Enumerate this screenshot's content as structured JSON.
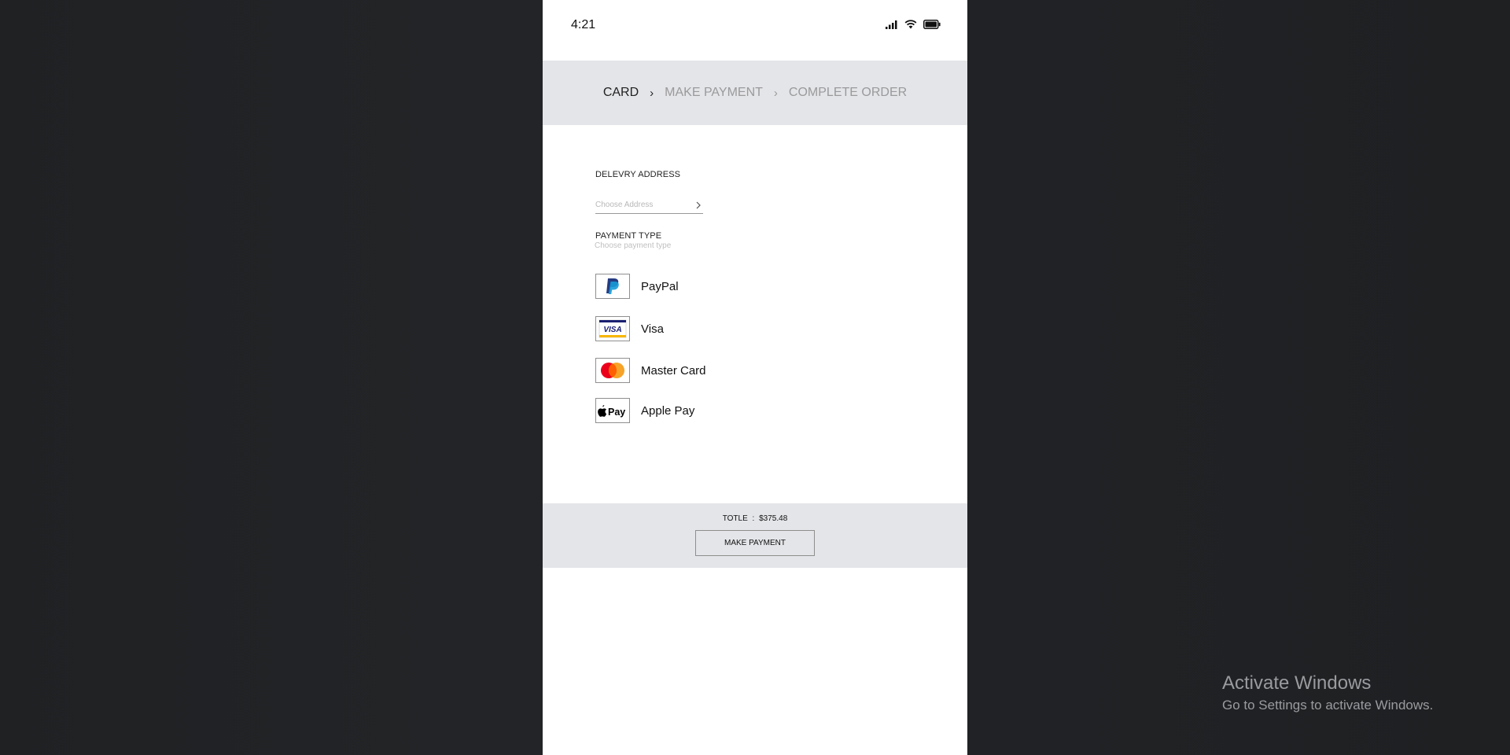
{
  "status_bar": {
    "time": "4:21"
  },
  "stepper": {
    "steps": [
      {
        "label": "CARD",
        "state": "active"
      },
      {
        "label": "MAKE PAYMENT",
        "state": "inactive"
      },
      {
        "label": "COMPLETE ORDER",
        "state": "inactive"
      }
    ],
    "separator": "›"
  },
  "delivery": {
    "title": "DELEVRY ADDRESS",
    "placeholder": "Choose Address"
  },
  "payment": {
    "title": "PAYMENT TYPE",
    "hint": "Choose payment type",
    "options": [
      {
        "label": "PayPal",
        "icon": "paypal-icon"
      },
      {
        "label": "Visa",
        "icon": "visa-icon"
      },
      {
        "label": "Master Card",
        "icon": "mastercard-icon"
      },
      {
        "label": "Apple Pay",
        "icon": "apple-pay-icon"
      }
    ]
  },
  "footer": {
    "total_label": "TOTLE",
    "total_sep": ":",
    "total_value": "$375.48",
    "button_label": "MAKE PAYMENT"
  },
  "windows_watermark": {
    "title": "Activate Windows",
    "subtitle": "Go to Settings to activate Windows."
  },
  "colors": {
    "phone_bg": "#ffffff",
    "band_bg": "#e4e5e8",
    "desktop_bg": "#212325",
    "paypal_dark": "#253b80",
    "paypal_light": "#179bd7",
    "visa_blue": "#1a1f71",
    "visa_gold": "#f7b600",
    "mc_red": "#eb001b",
    "mc_orange": "#f79e1b"
  }
}
